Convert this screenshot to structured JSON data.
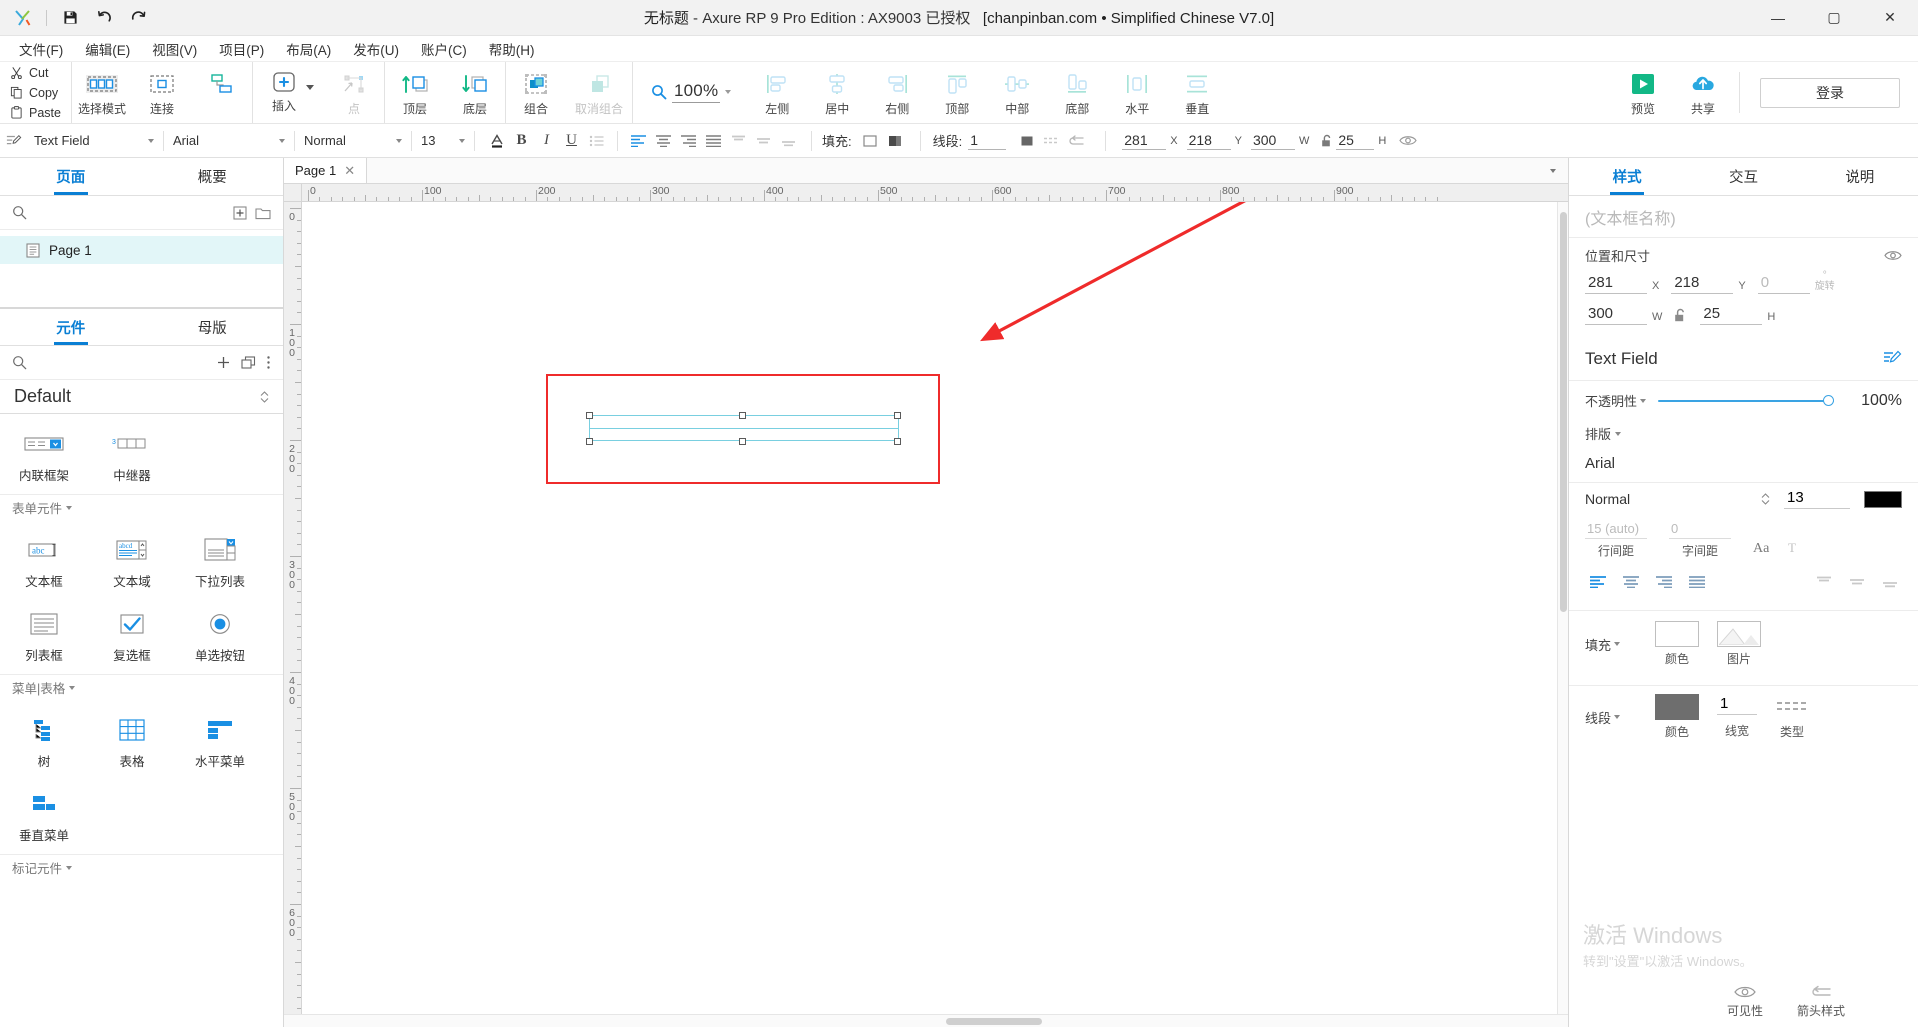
{
  "titlebar": {
    "doc_title": "无标题",
    "app_title": " - Axure RP 9 Pro Edition : AX9003 已授权",
    "license_note": "[chanpinban.com • Simplified Chinese V7.0]",
    "save_icon": "save-icon",
    "undo_icon": "undo-icon",
    "redo_icon": "redo-icon",
    "minimize": "—",
    "maximize": "▢",
    "close": "✕"
  },
  "menubar": {
    "items": [
      {
        "label": "文件(F)"
      },
      {
        "label": "编辑(E)"
      },
      {
        "label": "视图(V)"
      },
      {
        "label": "项目(P)"
      },
      {
        "label": "布局(A)"
      },
      {
        "label": "发布(U)"
      },
      {
        "label": "账户(C)"
      },
      {
        "label": "帮助(H)"
      }
    ]
  },
  "clipboard": {
    "cut": "Cut",
    "copy": "Copy",
    "paste": "Paste"
  },
  "toolbar": {
    "items": [
      {
        "label": "选择模式",
        "icon": "select-mode-icon",
        "dim": false,
        "active": true
      },
      {
        "label": "连接",
        "icon": "connect-icon",
        "dim": false,
        "active": false
      },
      {
        "label": "插入",
        "icon": "insert-plus-icon",
        "dim": false,
        "active": false
      },
      {
        "label": "点",
        "icon": "point-icon",
        "dim": true,
        "active": false
      },
      {
        "label": "顶层",
        "icon": "bring-front-icon",
        "dim": false,
        "active": false
      },
      {
        "label": "底层",
        "icon": "send-back-icon",
        "dim": false,
        "active": false
      },
      {
        "label": "组合",
        "icon": "group-icon",
        "dim": false,
        "active": false
      },
      {
        "label": "取消组合",
        "icon": "ungroup-icon",
        "dim": true,
        "active": false
      }
    ],
    "zoom": {
      "value": "100%",
      "icon": "magnifier-icon"
    },
    "align": [
      {
        "label": "左侧",
        "icon": "align-left-icon"
      },
      {
        "label": "居中",
        "icon": "align-center-h-icon"
      },
      {
        "label": "右侧",
        "icon": "align-right-icon"
      },
      {
        "label": "顶部",
        "icon": "align-top-icon"
      },
      {
        "label": "中部",
        "icon": "align-middle-icon"
      },
      {
        "label": "底部",
        "icon": "align-bottom-icon"
      },
      {
        "label": "水平",
        "icon": "distribute-h-icon"
      },
      {
        "label": "垂直",
        "icon": "distribute-v-icon"
      }
    ],
    "preview": {
      "label": "预览",
      "icon": "play-icon"
    },
    "share": {
      "label": "共享",
      "icon": "cloud-icon"
    },
    "login": "登录"
  },
  "styletoolbar": {
    "widget_type": "Text Field",
    "font_family": "Arial",
    "font_weight": "Normal",
    "font_size": "13",
    "font_color_icon": "font-color-icon",
    "bold": "B",
    "italic": "I",
    "underline": "U",
    "list": "list-icon",
    "align_left": "align-text-left-icon",
    "align_center": "align-text-center-icon",
    "align_right": "align-text-right-icon",
    "align_justify": "align-text-justify-icon",
    "valign_top": "valign-top-icon",
    "valign_middle": "valign-middle-icon",
    "valign_bottom": "valign-bottom-icon",
    "fill_label": "填充:",
    "line_label": "线段:",
    "line_width": "1",
    "pos": {
      "x": "281",
      "x_unit": "X",
      "y": "218",
      "y_unit": "Y",
      "w": "300",
      "w_unit": "W",
      "h": "25",
      "h_unit": "H"
    },
    "eye_icon": "visibility-icon",
    "lock_icon": "lock-open-icon"
  },
  "left_panel": {
    "tabs": [
      {
        "label": "页面",
        "active": true
      },
      {
        "label": "概要",
        "active": false
      }
    ],
    "page_toolbar": {
      "search_icon": "search-icon",
      "add_page_icon": "add-page-icon",
      "add_folder_icon": "add-folder-icon"
    },
    "pages": [
      {
        "label": "Page 1",
        "icon": "page-icon",
        "selected": true
      }
    ],
    "lib_tabs": [
      {
        "label": "元件",
        "active": true
      },
      {
        "label": "母版",
        "active": false
      }
    ],
    "lib_toolbar": {
      "search_icon": "search-icon",
      "add_icon": "plus-icon",
      "stack_icon": "duplicate-icon",
      "more_icon": "more-options-icon"
    },
    "library_name": "Default",
    "sections": [
      {
        "title": null,
        "widgets": [
          {
            "label": "内联框架",
            "icon": "inline-frame-icon"
          },
          {
            "label": "中继器",
            "icon": "repeater-icon"
          }
        ]
      },
      {
        "title": "表单元件",
        "widgets": [
          {
            "label": "文本框",
            "icon": "text-field-icon"
          },
          {
            "label": "文本域",
            "icon": "text-area-icon"
          },
          {
            "label": "下拉列表",
            "icon": "droplist-icon"
          },
          {
            "label": "列表框",
            "icon": "listbox-icon"
          },
          {
            "label": "复选框",
            "icon": "checkbox-icon"
          },
          {
            "label": "单选按钮",
            "icon": "radio-button-icon"
          }
        ]
      },
      {
        "title": "菜单|表格",
        "widgets": [
          {
            "label": "树",
            "icon": "tree-icon"
          },
          {
            "label": "表格",
            "icon": "table-icon"
          },
          {
            "label": "水平菜单",
            "icon": "horizontal-menu-icon"
          },
          {
            "label": "垂直菜单",
            "icon": "vertical-menu-icon"
          }
        ]
      },
      {
        "title": "标记元件",
        "widgets": []
      }
    ]
  },
  "canvas": {
    "page_tab": {
      "label": "Page 1",
      "close": "✕"
    },
    "h_ruler_labels": [
      "0",
      "100",
      "200",
      "300",
      "400",
      "500",
      "600",
      "700",
      "800",
      "900"
    ],
    "v_ruler_labels": [
      "0",
      "100",
      "200",
      "300",
      "400",
      "500",
      "600"
    ],
    "annotation": {
      "type": "red-arrow",
      "color": "#ef2b2b"
    },
    "highlight_box": {
      "color": "#ef2b2b"
    },
    "selected_widget": {
      "type": "text-field",
      "handle_color": "#79cfe0"
    }
  },
  "right_panel": {
    "tabs": [
      {
        "label": "样式",
        "active": true
      },
      {
        "label": "交互",
        "active": false
      },
      {
        "label": "说明",
        "active": false
      }
    ],
    "name_placeholder": "(文本框名称)",
    "position_section": {
      "title": "位置和尺寸",
      "eye_icon": "visibility-icon",
      "x": "281",
      "x_label": "X",
      "y": "218",
      "y_label": "Y",
      "rotate": "0",
      "rotate_label": "旋转",
      "rotate_unit": "°",
      "w": "300",
      "w_label": "W",
      "h": "25",
      "h_label": "H",
      "lock_icon": "lock-open-icon"
    },
    "widget_type": "Text Field",
    "edit_icon": "edit-style-icon",
    "opacity": {
      "label": "不透明性",
      "value": "100%"
    },
    "typography": {
      "title": "排版",
      "font": "Arial",
      "weight": "Normal",
      "size": "13",
      "color": "#000000",
      "line_height": "15 (auto)",
      "line_height_label": "行间距",
      "letter_spacing": "0",
      "letter_spacing_label": "字间距",
      "case_icon": "text-case-icon",
      "decoration_icon": "text-decoration-icon",
      "align_icons": [
        "align-text-left-icon",
        "align-text-center-icon",
        "align-text-right-icon",
        "align-text-justify-icon"
      ],
      "valign_icons": [
        "valign-top-icon",
        "valign-middle-icon",
        "valign-bottom-icon"
      ]
    },
    "fill": {
      "title": "填充",
      "color_label": "颜色",
      "image_label": "图片"
    },
    "line": {
      "title": "线段",
      "color_label": "颜色",
      "width_value": "1",
      "width_label": "线宽",
      "type_label": "类型"
    },
    "bottom": {
      "visible_label": "可见性",
      "arrow_label": "箭头样式"
    },
    "watermark": {
      "line1": "激活 Windows",
      "line2": "转到\"设置\"以激活 Windows。"
    }
  }
}
